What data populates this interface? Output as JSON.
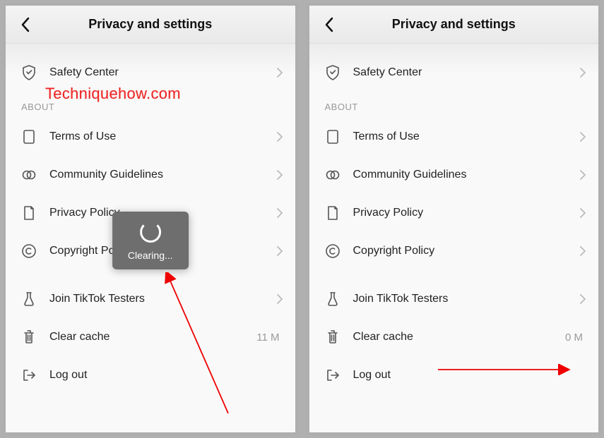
{
  "panelLeft": {
    "header": {
      "title": "Privacy and settings"
    },
    "watermark": "Techniquehow.com",
    "toast": "Clearing...",
    "rows": {
      "safety": "Safety Center",
      "about": "ABOUT",
      "terms": "Terms of Use",
      "guidelines": "Community Guidelines",
      "privacy": "Privacy Policy",
      "copyright": "Copyright Policy",
      "testers": "Join TikTok Testers",
      "cache_label": "Clear cache",
      "cache_value": "11 M",
      "logout": "Log out"
    }
  },
  "panelRight": {
    "header": {
      "title": "Privacy and settings"
    },
    "rows": {
      "safety": "Safety Center",
      "about": "ABOUT",
      "terms": "Terms of Use",
      "guidelines": "Community Guidelines",
      "privacy": "Privacy Policy",
      "copyright": "Copyright Policy",
      "testers": "Join TikTok Testers",
      "cache_label": "Clear cache",
      "cache_value": "0 M",
      "logout": "Log out"
    }
  }
}
